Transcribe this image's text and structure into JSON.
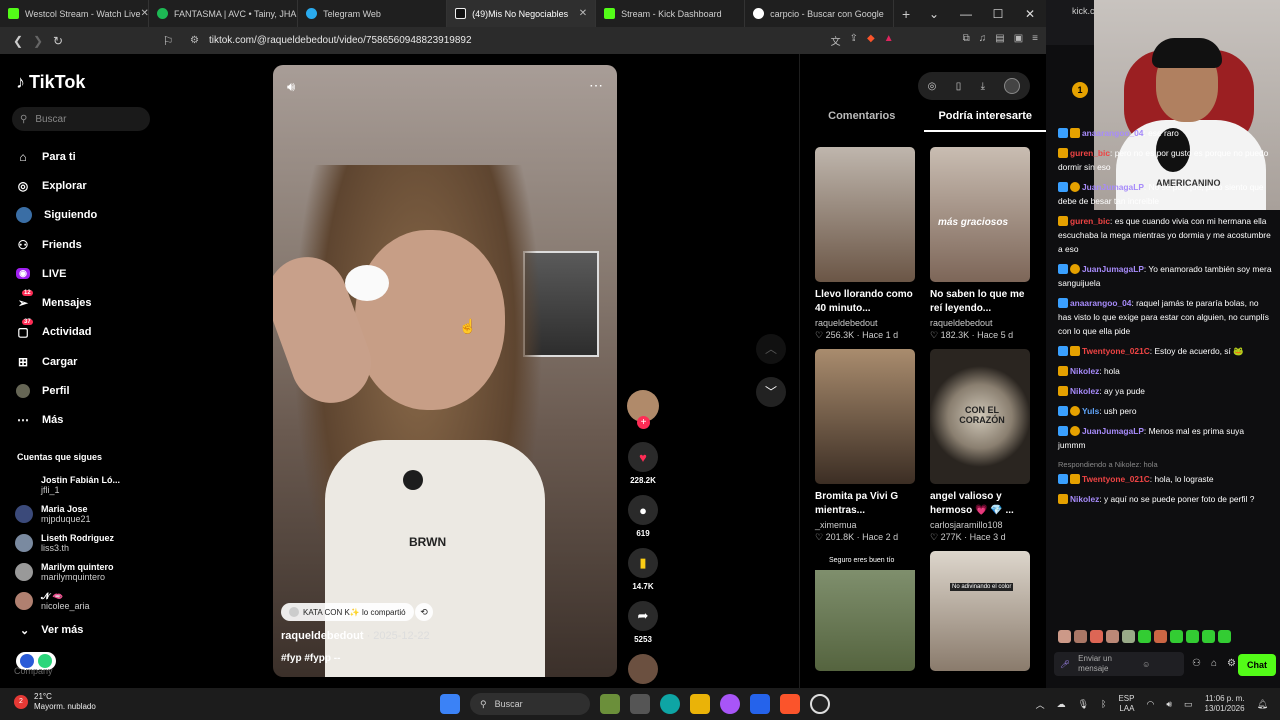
{
  "browser": {
    "tabs": [
      {
        "title": "Westcol Stream - Watch Live",
        "color": "#53fc18"
      },
      {
        "title": "FANTASMA | AVC • Tainy, JHA",
        "color": "#1db954"
      },
      {
        "title": "Telegram Web",
        "color": "#2aabee"
      },
      {
        "title": "(49)Mis No Negociables",
        "color": "#111111"
      },
      {
        "title": "Stream - Kick Dashboard",
        "color": "#53fc18"
      },
      {
        "title": "carpcio - Buscar con Google",
        "color": "#ffffff"
      }
    ],
    "url": "tiktok.com/@raqueldebedout/video/7586560948823919892",
    "chat_url_partial": "kick.com"
  },
  "tiktok": {
    "logo": "TikTok",
    "search_placeholder": "Buscar",
    "nav": [
      {
        "label": "Para ti",
        "icon": "home-icon"
      },
      {
        "label": "Explorar",
        "icon": "compass-icon"
      },
      {
        "label": "Siguiendo",
        "icon": "following-icon"
      },
      {
        "label": "Friends",
        "icon": "friends-icon"
      },
      {
        "label": "LIVE",
        "icon": "live-icon"
      },
      {
        "label": "Mensajes",
        "icon": "messages-icon",
        "badge": "12"
      },
      {
        "label": "Actividad",
        "icon": "activity-icon",
        "badge": "37"
      },
      {
        "label": "Cargar",
        "icon": "upload-icon"
      },
      {
        "label": "Perfil",
        "icon": "profile-icon"
      },
      {
        "label": "Más",
        "icon": "more-icon"
      }
    ],
    "following_title": "Cuentas que sigues",
    "following": [
      {
        "name": "Jostin Fabián Ló...",
        "handle": "jfli_1"
      },
      {
        "name": "Maria Jose",
        "handle": "mjpduque21"
      },
      {
        "name": "Liseth Rodriguez",
        "handle": "liss3.th"
      },
      {
        "name": "Marilym quintero",
        "handle": "marilymquintero"
      },
      {
        "name": "𝓝 🫦",
        "handle": "nicolee_aria"
      }
    ],
    "ver_mas": "Ver más",
    "company": "Company",
    "video": {
      "shared_by": "KATA CON K✨ lo compartió",
      "author": "raqueldebedout",
      "date": " · 2025-12-22",
      "tags": "#fyp #fypp --",
      "shirt_text": "BRWN",
      "likes": "228.2K",
      "comments": "619",
      "saves": "14.7K",
      "shares": "5253"
    },
    "panel_tabs": [
      "Comentarios",
      "Podría interesarte"
    ],
    "suggestions": [
      {
        "title": "Llevo llorando como 40 minuto...",
        "author": "raqueldebedout",
        "likes": "256.3K",
        "ago": "Hace 1 d",
        "color": "#8f7a6c"
      },
      {
        "title": "No saben lo que me reí leyendo...",
        "author": "raqueldebedout",
        "likes": "182.3K",
        "ago": "Hace 5 d",
        "color": "#a89080",
        "overlay": "más graciosos"
      },
      {
        "title": "Bromita pa Vivi G mientras...",
        "author": "_ximemua",
        "likes": "201.8K",
        "ago": "Hace 2 d",
        "color": "#6e5a48"
      },
      {
        "title": "angel valioso y hermoso 💗 💎 ...",
        "author": "carlosjaramillo108",
        "likes": "277K",
        "ago": "Hace 3 d",
        "color": "#3f3a33",
        "overlay": "CON EL CORAZÓN"
      },
      {
        "title": "",
        "author": "",
        "likes": "",
        "ago": "",
        "color": "#7a8a6a",
        "overlay": "Seguro eres buen tío"
      },
      {
        "title": "",
        "author": "",
        "likes": "",
        "ago": "",
        "color": "#c9c2b8",
        "overlay": "No adivinando el color"
      }
    ]
  },
  "chat": {
    "messages": [
      {
        "user": "anaarangoo_04",
        "color": "#a78bfa",
        "text": "ese raro"
      },
      {
        "user": "guren_bic",
        "color": "#ef4444",
        "text": "pero no es por gusto es porque no puedo dormir sin eso"
      },
      {
        "user": "JuanJumagaLP",
        "color": "#a78bfa",
        "text": "No sé por qué, pero siento que debe de besar tan increible"
      },
      {
        "user": "guren_bic",
        "color": "#ef4444",
        "text": "es que cuando vivia con mi hermana ella escuchaba la mega mientras yo dormia y me acostumbre a eso"
      },
      {
        "user": "JuanJumagaLP",
        "color": "#a78bfa",
        "text": "Yo enamorado también soy mera sanguijuela"
      },
      {
        "user": "anaarangoo_04",
        "color": "#a78bfa",
        "text": "raquel jamás te pararía bolas, no has visto lo que exige para estar con alguien, no cumplís con lo que ella pide"
      },
      {
        "user": "Twentyone_021C",
        "color": "#ef4444",
        "text": "Estoy de acuerdo, sí 🐸"
      },
      {
        "user": "Nikolez",
        "color": "#a78bfa",
        "text": "hola"
      },
      {
        "user": "Nikolez",
        "color": "#a78bfa",
        "text": "ay ya pude"
      },
      {
        "user": "Yuls",
        "color": "#60a5fa",
        "text": "ush pero"
      },
      {
        "user": "JuanJumagaLP",
        "color": "#a78bfa",
        "text": "Menos mal es prima suya jummm"
      },
      {
        "user": "Twentyone_021C",
        "color": "#ef4444",
        "text": "hola, lo lograste",
        "reply": "Respondiendo a Nikolez: hola"
      },
      {
        "user": "Nikolez",
        "color": "#a78bfa",
        "text": "y aquí no se puede poner foto de perfil ?"
      }
    ],
    "input_placeholder": "Enviar un mensaje",
    "chat_button": "Chat",
    "rank": "1",
    "cam_shirt_text": "AMERICANINO"
  },
  "taskbar": {
    "temp": "21°C",
    "weather": "Mayorm. nublado",
    "search": "Buscar",
    "lang": "ESP",
    "lang2": "LAA",
    "time": "11:06 p. m.",
    "date": "13/01/2026",
    "weather_badge": "2"
  }
}
